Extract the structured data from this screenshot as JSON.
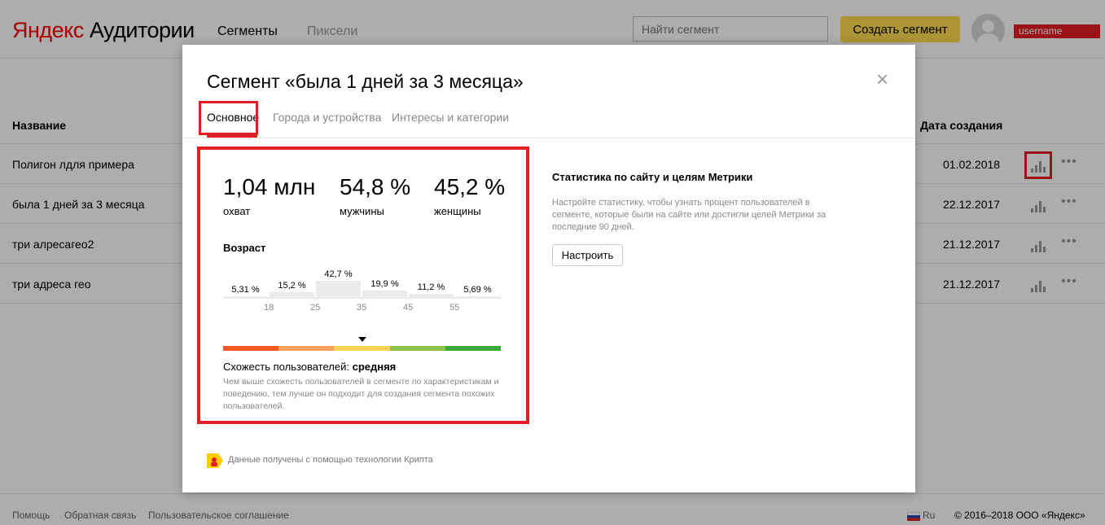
{
  "header": {
    "logo_y": "Яндекс",
    "logo_rest": "Аудитории",
    "nav": [
      {
        "label": "Сегменты"
      },
      {
        "label": "Пиксели"
      }
    ],
    "search_placeholder": "Найти сегмент",
    "create_label": "Создать сегмент",
    "user_label": "username"
  },
  "list": {
    "col_name": "Название",
    "col_date": "Дата создания",
    "rows": [
      {
        "name": "Полигон лдля примера",
        "date": "01.02.2018"
      },
      {
        "name": "была 1 дней за 3 месяца",
        "date": "22.12.2017"
      },
      {
        "name": "три алресагео2",
        "date": "21.12.2017"
      },
      {
        "name": "три адреса гео",
        "date": "21.12.2017"
      }
    ],
    "more_glyph": "•••"
  },
  "footer": {
    "help": "Помощь",
    "feedback": "Обратная связь",
    "agreement": "Пользовательское соглашение",
    "lang": "Ru",
    "copyright": "© 2016–2018 ООО «Яндекс»"
  },
  "modal": {
    "title": "Сегмент «была 1 дней за 3 месяца»",
    "close_glyph": "×",
    "tabs": [
      {
        "label": "Основное"
      },
      {
        "label": "Города и устройства"
      },
      {
        "label": "Интересы и категории"
      }
    ],
    "reach": {
      "value": "1,04 млн",
      "label": "охват"
    },
    "men": {
      "value": "54,8 %",
      "label": "мужчины"
    },
    "women": {
      "value": "45,2 %",
      "label": "женщины"
    },
    "age_title": "Возраст",
    "age": {
      "labels": [
        "5,31 %",
        "15,2 %",
        "42,7 %",
        "19,9 %",
        "11,2 %",
        "5,69 %"
      ],
      "values": [
        5.31,
        15.2,
        42.7,
        19.9,
        11.2,
        5.69
      ],
      "ticks": [
        "18",
        "25",
        "35",
        "45",
        "55"
      ]
    },
    "similarity": {
      "label": "Схожесть пользователей: ",
      "value": "средняя",
      "level": 0.5,
      "description": "Чем выше схожесть пользователей в сегменте по характеристикам и поведению, тем лучше он подходит для создания сегмента похожих пользователей.",
      "scale_colors": [
        "#f15a24",
        "#f7a35c",
        "#f9d457",
        "#8bc34a",
        "#3daa3d"
      ]
    },
    "metrika": {
      "title": "Статистика по сайту и целям Метрики",
      "description": "Настройте статистику, чтобы узнать процент пользователей в сегменте, которые были на сайте или достигли целей Метрики за последние 90 дней.",
      "button": "Настроить"
    },
    "kripta": "Данные получены с помощью технологии Крипта"
  },
  "colors": {
    "accent": "#ffdb4d",
    "highlight": "#e31d24"
  }
}
